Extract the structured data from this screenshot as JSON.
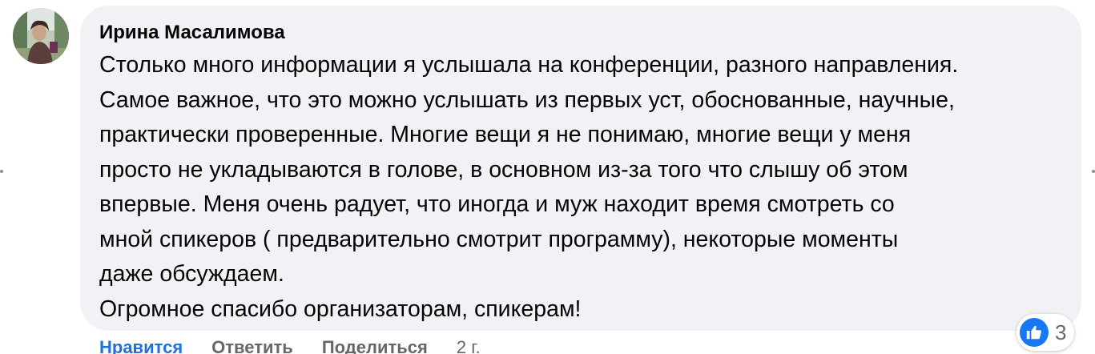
{
  "comment": {
    "author": "Ирина Масалимова",
    "lines": [
      "Столько много информации я услышала на конференции, разного направления.",
      "Самое важное, что это можно услышать из первых уст, обоснованные, научные,",
      "практически проверенные. Многие вещи я не понимаю, многие вещи у меня",
      "просто не укладываются в голове, в основном из-за того что слышу об этом",
      "впервые. Меня очень радует, что иногда и муж находит время смотреть со",
      "мной спикеров ( предварительно смотрит программу), некоторые моменты",
      "даже обсуждаем.",
      "Огромное спасибо организаторам, спикерам!"
    ]
  },
  "actions": {
    "like": "Нравится",
    "reply": "Ответить",
    "share": "Поделиться",
    "time": "2 г."
  },
  "reactions": {
    "icon": "thumbs-up-icon",
    "count": "3"
  },
  "colors": {
    "bubble": "#f0f2f5",
    "like_blue": "#1877f2",
    "link_blue": "#216fdb",
    "muted": "#65676b"
  }
}
